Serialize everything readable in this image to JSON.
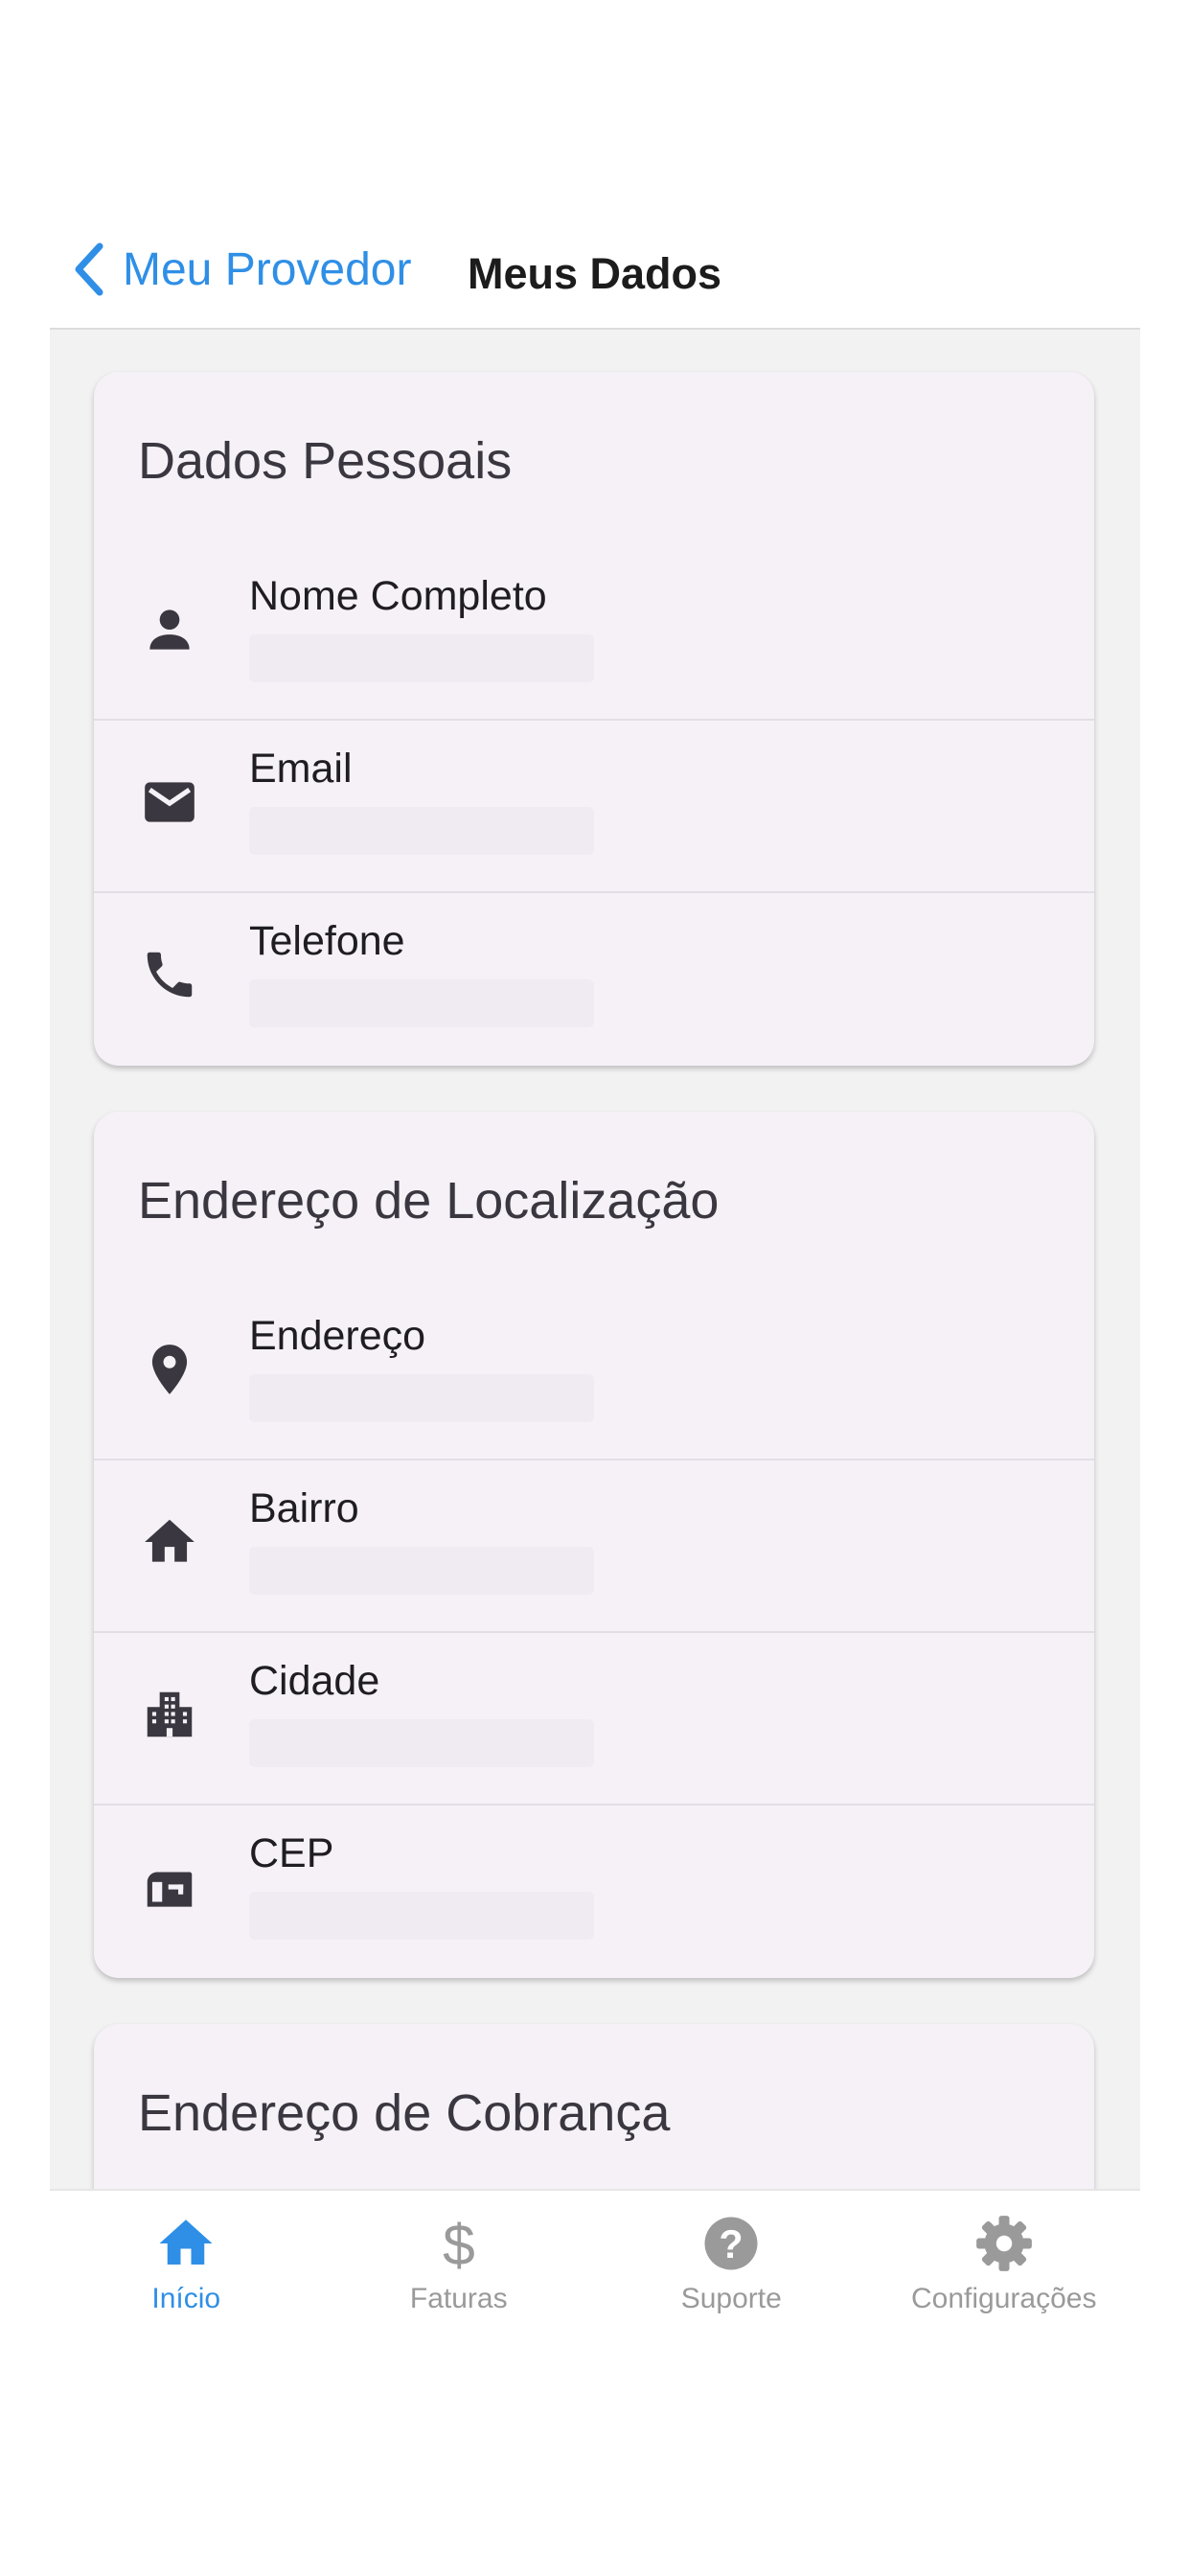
{
  "header": {
    "back_label": "Meu Provedor",
    "title": "Meus Dados"
  },
  "cards": [
    {
      "title": "Dados Pessoais",
      "rows": [
        {
          "label": "Nome Completo",
          "icon": "person-icon"
        },
        {
          "label": "Email",
          "icon": "mail-icon"
        },
        {
          "label": "Telefone",
          "icon": "phone-icon"
        }
      ]
    },
    {
      "title": "Endereço de Localização",
      "rows": [
        {
          "label": "Endereço",
          "icon": "location-pin-icon"
        },
        {
          "label": "Bairro",
          "icon": "home-icon"
        },
        {
          "label": "Cidade",
          "icon": "city-icon"
        },
        {
          "label": "CEP",
          "icon": "mailbox-icon"
        }
      ]
    },
    {
      "title": "Endereço de Cobrança",
      "rows": []
    }
  ],
  "tabs": [
    {
      "label": "Início",
      "icon": "home-icon",
      "active": true
    },
    {
      "label": "Faturas",
      "icon": "dollar-icon",
      "active": false
    },
    {
      "label": "Suporte",
      "icon": "help-icon",
      "active": false
    },
    {
      "label": "Configurações",
      "icon": "gear-icon",
      "active": false
    }
  ],
  "colors": {
    "accent": "#2f8fe6",
    "inactive": "#9a9a9a",
    "icon": "#3a3740",
    "card_bg": "#f5f1f7",
    "content_bg": "#f2f2f2"
  }
}
